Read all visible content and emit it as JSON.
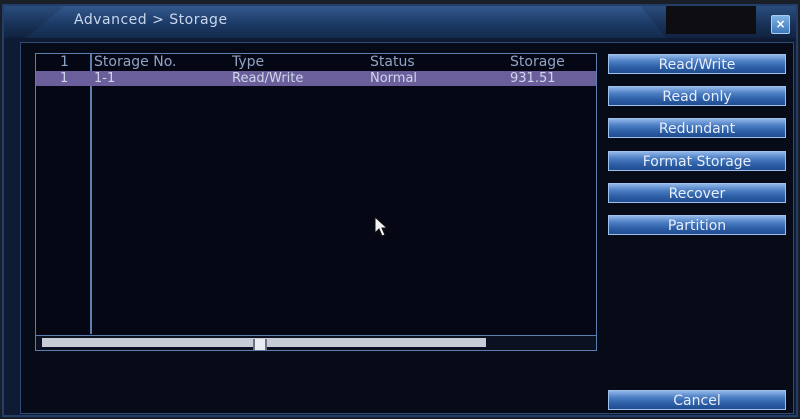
{
  "window": {
    "title": "Advanced > Storage",
    "close_label": "×"
  },
  "table": {
    "headers": [
      "1",
      "Storage No.",
      "Type",
      "Status",
      "Storage"
    ],
    "rows": [
      [
        "1",
        "1-1",
        "Read/Write",
        "Normal",
        "931.51"
      ]
    ],
    "scroll_fraction": 0.49
  },
  "actions": {
    "buttons": [
      "Read/Write",
      "Read only",
      "Redundant",
      "Format Storage",
      "Recover",
      "Partition"
    ],
    "cancel_label": "Cancel"
  },
  "colors": {
    "selected_row": "#6a5f9b",
    "button_accent": "#4d7fc4",
    "panel_border": "#5b7fb0"
  }
}
